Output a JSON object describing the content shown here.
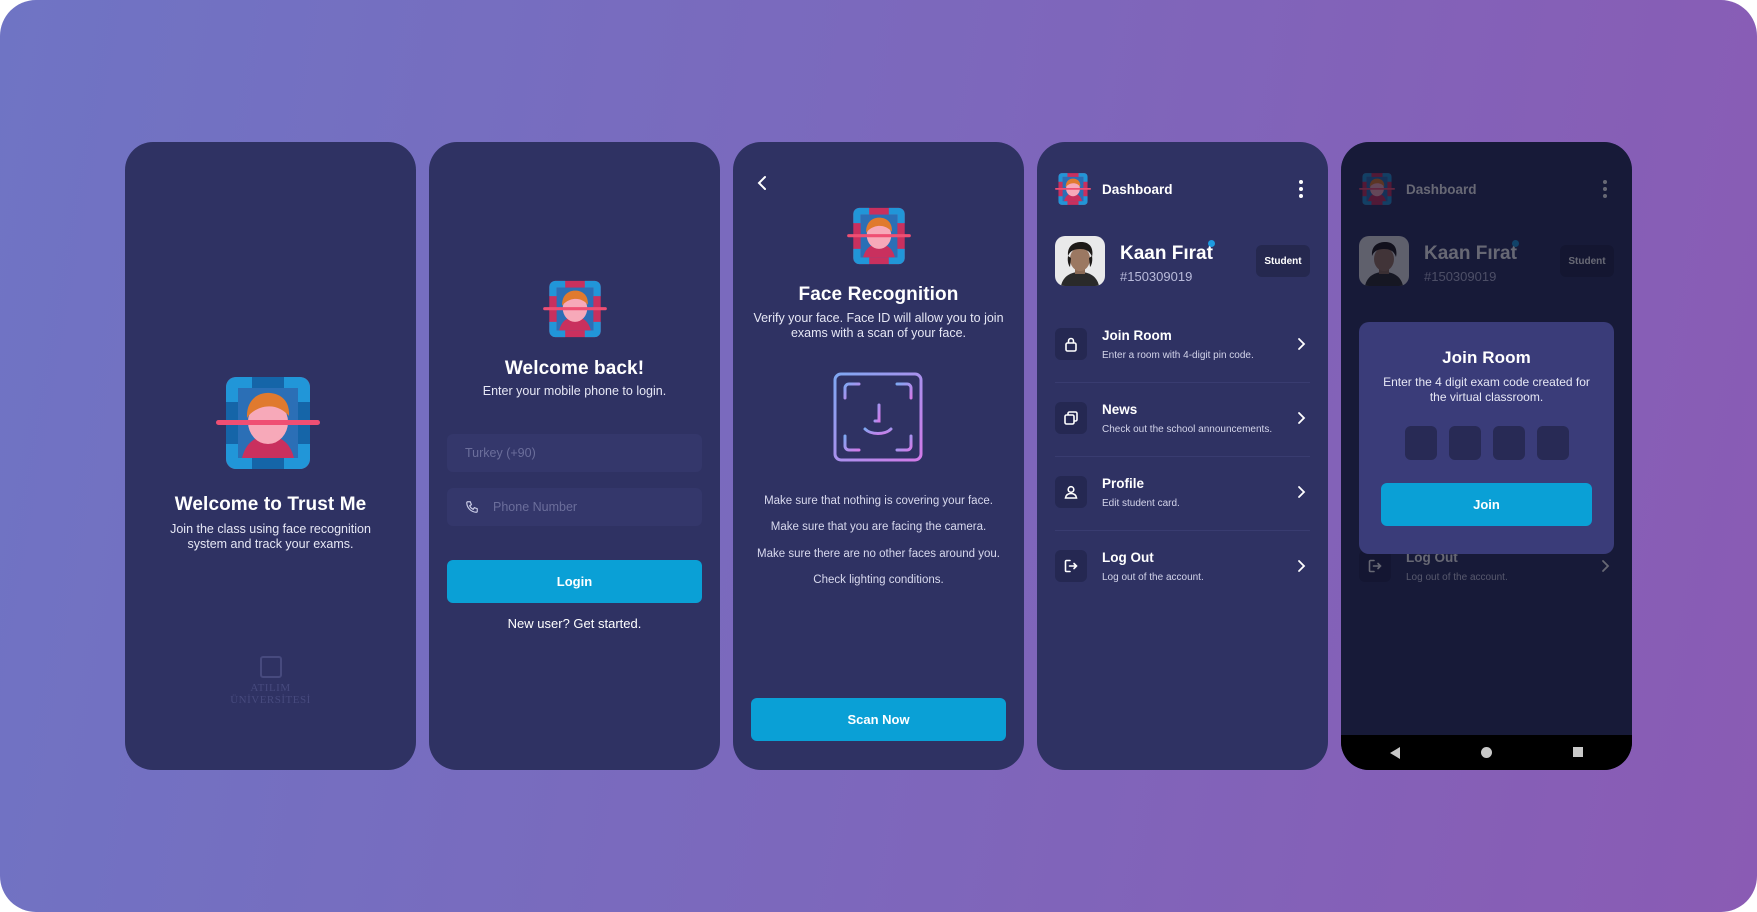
{
  "colors": {
    "background_start": "#6f74c4",
    "background_end": "#8a5bb4",
    "phone_bg": "#2f3263",
    "accent": "#0aa0d6",
    "online_dot": "#1e9be0"
  },
  "screen_welcome": {
    "title": "Welcome to Trust Me",
    "subtitle_line1": "Join the class using face recognition",
    "subtitle_line2": "system and track your exams.",
    "university_line1": "ATILIM",
    "university_line2": "ÜNİVERSİTESİ",
    "icon": "face-recognition-logo"
  },
  "screen_login": {
    "title": "Welcome back!",
    "subtitle": "Enter your mobile phone to login.",
    "country_placeholder": "Turkey (+90)",
    "phone_placeholder": "Phone Number",
    "login_label": "Login",
    "signup_link": "New user? Get started.",
    "phone_icon": "phone-icon"
  },
  "screen_face": {
    "title": "Face Recognition",
    "subtitle_line1": "Verify your face. Face ID will allow you to join",
    "subtitle_line2": "exams with a scan of your face.",
    "tips": [
      "Make sure that nothing is covering your face.",
      "Make sure that you are facing the camera.",
      "Make sure there are no other faces around you.",
      "Check lighting conditions."
    ],
    "scan_label": "Scan Now",
    "icon": "face-id-icon"
  },
  "screen_dashboard": {
    "title": "Dashboard",
    "user_name": "Kaan Fırat",
    "user_id": "#150309019",
    "role_badge": "Student",
    "menu": [
      {
        "title": "Join Room",
        "desc": "Enter a room with 4-digit pin code.",
        "icon": "lock-icon"
      },
      {
        "title": "News",
        "desc": "Check out the school announcements.",
        "icon": "copy-icon"
      },
      {
        "title": "Profile",
        "desc": "Edit student card.",
        "icon": "user-icon"
      },
      {
        "title": "Log Out",
        "desc": "Log out of the account.",
        "icon": "logout-icon"
      }
    ]
  },
  "screen_join_modal": {
    "title": "Join Room",
    "desc_line1": "Enter the 4 digit exam code created for",
    "desc_line2": "the virtual classroom.",
    "code_boxes": [
      "",
      "",
      "",
      ""
    ],
    "join_label": "Join",
    "nav_icons": [
      "back-triangle-icon",
      "home-circle-icon",
      "recents-square-icon"
    ]
  }
}
